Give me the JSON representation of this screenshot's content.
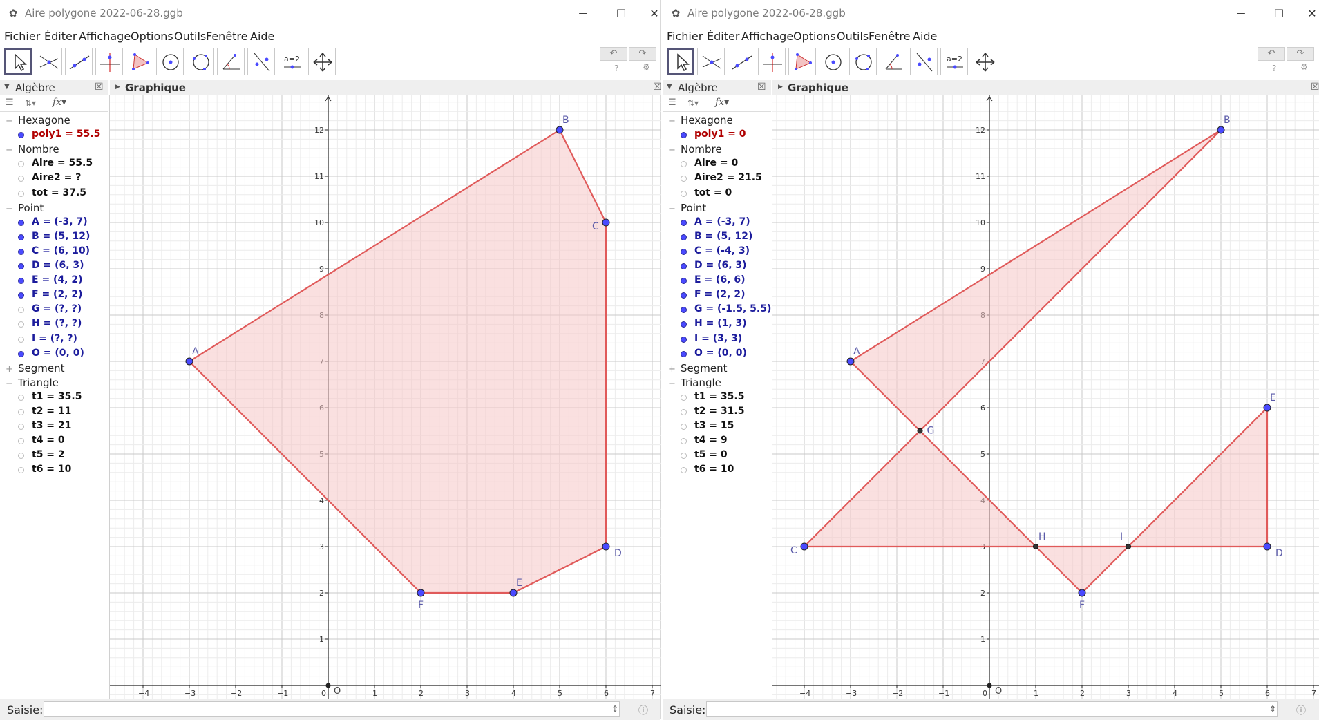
{
  "windows": [
    {
      "title": "Aire polygone 2022-06-28.ggb",
      "menu": [
        "Fichier",
        "Éditer",
        "Affichage",
        "Options",
        "Outils",
        "Fenêtre",
        "Aide"
      ],
      "algebra_title": "Algèbre",
      "graph_title": "Graphique",
      "input_label": "Saisie:",
      "groups": [
        {
          "name": "Hexagone",
          "sign": "−",
          "items": [
            {
              "text": "poly1 = 55.5",
              "shown": true,
              "kind": "poly"
            }
          ]
        },
        {
          "name": "Nombre",
          "sign": "−",
          "items": [
            {
              "text": "Aire = 55.5",
              "shown": false,
              "kind": "num"
            },
            {
              "text": "Aire2 = ?",
              "shown": false,
              "kind": "num"
            },
            {
              "text": "tot = 37.5",
              "shown": false,
              "kind": "num"
            }
          ]
        },
        {
          "name": "Point",
          "sign": "−",
          "items": [
            {
              "text": "A = (-3, 7)",
              "shown": true,
              "kind": "pt"
            },
            {
              "text": "B = (5, 12)",
              "shown": true,
              "kind": "pt"
            },
            {
              "text": "C = (6, 10)",
              "shown": true,
              "kind": "pt"
            },
            {
              "text": "D = (6, 3)",
              "shown": true,
              "kind": "pt"
            },
            {
              "text": "E = (4, 2)",
              "shown": true,
              "kind": "pt"
            },
            {
              "text": "F = (2, 2)",
              "shown": true,
              "kind": "pt"
            },
            {
              "text": "G = (?, ?)",
              "shown": false,
              "kind": "pt"
            },
            {
              "text": "H = (?, ?)",
              "shown": false,
              "kind": "pt"
            },
            {
              "text": "I = (?, ?)",
              "shown": false,
              "kind": "pt"
            },
            {
              "text": "O = (0, 0)",
              "shown": true,
              "kind": "pt"
            }
          ]
        },
        {
          "name": "Segment",
          "sign": "+",
          "items": []
        },
        {
          "name": "Triangle",
          "sign": "−",
          "items": [
            {
              "text": "t1 = 35.5",
              "shown": false,
              "kind": "num"
            },
            {
              "text": "t2 = 11",
              "shown": false,
              "kind": "num"
            },
            {
              "text": "t3 = 21",
              "shown": false,
              "kind": "num"
            },
            {
              "text": "t4 = 0",
              "shown": false,
              "kind": "num"
            },
            {
              "text": "t5 = 2",
              "shown": false,
              "kind": "num"
            },
            {
              "text": "t6 = 10",
              "shown": false,
              "kind": "num"
            }
          ]
        }
      ],
      "graph": {
        "xrange": [
          -4,
          7
        ],
        "yrange": [
          0,
          12
        ],
        "polygons": [
          [
            [
              -3,
              7
            ],
            [
              5,
              12
            ],
            [
              6,
              10
            ],
            [
              6,
              3
            ],
            [
              4,
              2
            ],
            [
              2,
              2
            ]
          ]
        ],
        "points": [
          {
            "label": "A",
            "x": -3,
            "y": 7,
            "style": "free",
            "lpos": "tr"
          },
          {
            "label": "B",
            "x": 5,
            "y": 12,
            "style": "free",
            "lpos": "tr"
          },
          {
            "label": "C",
            "x": 6,
            "y": 10,
            "style": "free",
            "lpos": "bl"
          },
          {
            "label": "D",
            "x": 6,
            "y": 3,
            "style": "free",
            "lpos": "br"
          },
          {
            "label": "E",
            "x": 4,
            "y": 2,
            "style": "free",
            "lpos": "tr"
          },
          {
            "label": "F",
            "x": 2,
            "y": 2,
            "style": "free",
            "lpos": "b"
          },
          {
            "label": "",
            "x": 0,
            "y": 0,
            "style": "origin",
            "lpos": "tr"
          }
        ],
        "origin_label": "O"
      }
    },
    {
      "title": "Aire polygone 2022-06-28.ggb",
      "menu": [
        "Fichier",
        "Éditer",
        "Affichage",
        "Options",
        "Outils",
        "Fenêtre",
        "Aide"
      ],
      "algebra_title": "Algèbre",
      "graph_title": "Graphique",
      "input_label": "Saisie:",
      "groups": [
        {
          "name": "Hexagone",
          "sign": "−",
          "items": [
            {
              "text": "poly1 = 0",
              "shown": true,
              "kind": "poly"
            }
          ]
        },
        {
          "name": "Nombre",
          "sign": "−",
          "items": [
            {
              "text": "Aire = 0",
              "shown": false,
              "kind": "num"
            },
            {
              "text": "Aire2 = 21.5",
              "shown": false,
              "kind": "num"
            },
            {
              "text": "tot = 0",
              "shown": false,
              "kind": "num"
            }
          ]
        },
        {
          "name": "Point",
          "sign": "−",
          "items": [
            {
              "text": "A = (-3, 7)",
              "shown": true,
              "kind": "pt"
            },
            {
              "text": "B = (5, 12)",
              "shown": true,
              "kind": "pt"
            },
            {
              "text": "C = (-4, 3)",
              "shown": true,
              "kind": "pt"
            },
            {
              "text": "D = (6, 3)",
              "shown": true,
              "kind": "pt"
            },
            {
              "text": "E = (6, 6)",
              "shown": true,
              "kind": "pt"
            },
            {
              "text": "F = (2, 2)",
              "shown": true,
              "kind": "pt"
            },
            {
              "text": "G = (-1.5, 5.5)",
              "shown": true,
              "kind": "pt"
            },
            {
              "text": "H = (1, 3)",
              "shown": true,
              "kind": "pt"
            },
            {
              "text": "I = (3, 3)",
              "shown": true,
              "kind": "pt"
            },
            {
              "text": "O = (0, 0)",
              "shown": true,
              "kind": "pt"
            }
          ]
        },
        {
          "name": "Segment",
          "sign": "+",
          "items": []
        },
        {
          "name": "Triangle",
          "sign": "−",
          "items": [
            {
              "text": "t1 = 35.5",
              "shown": false,
              "kind": "num"
            },
            {
              "text": "t2 = 31.5",
              "shown": false,
              "kind": "num"
            },
            {
              "text": "t3 = 15",
              "shown": false,
              "kind": "num"
            },
            {
              "text": "t4 = 9",
              "shown": false,
              "kind": "num"
            },
            {
              "text": "t5 = 0",
              "shown": false,
              "kind": "num"
            },
            {
              "text": "t6 = 10",
              "shown": false,
              "kind": "num"
            }
          ]
        }
      ],
      "graph": {
        "xrange": [
          -4,
          7
        ],
        "yrange": [
          0,
          12
        ],
        "polygons": [
          [
            [
              -3,
              7
            ],
            [
              5,
              12
            ],
            [
              -1.5,
              5.5
            ]
          ],
          [
            [
              -1.5,
              5.5
            ],
            [
              -4,
              3
            ],
            [
              1,
              3
            ]
          ],
          [
            [
              1,
              3
            ],
            [
              2,
              2
            ],
            [
              3,
              3
            ]
          ],
          [
            [
              3,
              3
            ],
            [
              6,
              3
            ],
            [
              6,
              6
            ]
          ]
        ],
        "points": [
          {
            "label": "A",
            "x": -3,
            "y": 7,
            "style": "free",
            "lpos": "tr"
          },
          {
            "label": "B",
            "x": 5,
            "y": 12,
            "style": "free",
            "lpos": "tr"
          },
          {
            "label": "C",
            "x": -4,
            "y": 3,
            "style": "free",
            "lpos": "bl"
          },
          {
            "label": "D",
            "x": 6,
            "y": 3,
            "style": "free",
            "lpos": "br"
          },
          {
            "label": "E",
            "x": 6,
            "y": 6,
            "style": "free",
            "lpos": "tr"
          },
          {
            "label": "F",
            "x": 2,
            "y": 2,
            "style": "free",
            "lpos": "b"
          },
          {
            "label": "G",
            "x": -1.5,
            "y": 5.5,
            "style": "dep",
            "lpos": "r"
          },
          {
            "label": "H",
            "x": 1,
            "y": 3,
            "style": "dep",
            "lpos": "tr"
          },
          {
            "label": "I",
            "x": 3,
            "y": 3,
            "style": "dep",
            "lpos": "tl"
          },
          {
            "label": "",
            "x": 0,
            "y": 0,
            "style": "origin",
            "lpos": "tr"
          }
        ],
        "origin_label": "O"
      }
    }
  ],
  "colors": {
    "polygon_stroke": "#e05a5a",
    "polygon_fill": "#f5c6c6",
    "point_fill": "#4a4aff",
    "point_text": "#1c1c9c",
    "poly_text": "#b00000"
  }
}
